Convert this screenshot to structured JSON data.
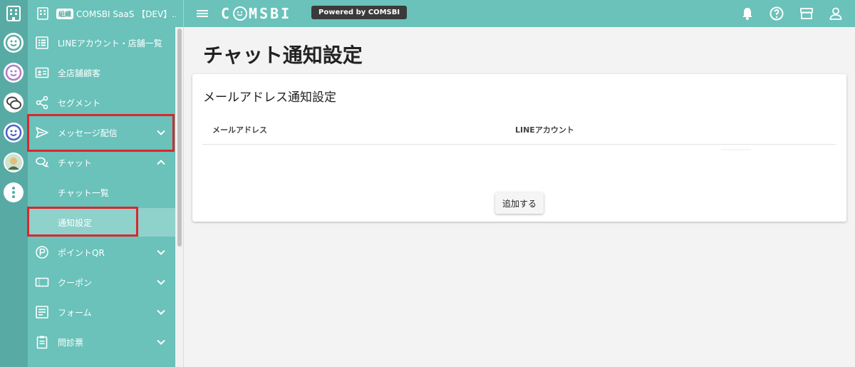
{
  "header": {
    "org_badge": "組織",
    "org_name": "COMSBI SaaS 【DEV】...",
    "logo_text": [
      "C",
      "MSBI"
    ],
    "powered_label": "Powered by COMSBI"
  },
  "sidebar": {
    "items": [
      {
        "label": "LINEアカウント・店舗一覧",
        "icon": "list-icon"
      },
      {
        "label": "全店舗顧客",
        "icon": "customer-card-icon"
      },
      {
        "label": "セグメント",
        "icon": "share-segment-icon"
      },
      {
        "label": "メッセージ配信",
        "icon": "send-icon"
      },
      {
        "label": "チャット",
        "icon": "chat-icon"
      },
      {
        "label": "チャット一覧",
        "icon": ""
      },
      {
        "label": "通知設定",
        "icon": ""
      },
      {
        "label": "ポイントQR",
        "icon": "point-icon"
      },
      {
        "label": "クーポン",
        "icon": "coupon-icon"
      },
      {
        "label": "フォーム",
        "icon": "form-icon"
      },
      {
        "label": "問診票",
        "icon": "clipboard-icon"
      }
    ]
  },
  "main": {
    "page_title": "チャット通知設定",
    "card_title": "メールアドレス通知設定",
    "columns": [
      "メールアドレス",
      "LINEアカウント"
    ],
    "add_button": "追加する"
  },
  "colors": {
    "accent": "#6ac2ba",
    "rail": "#58aba4",
    "highlight": "#d9272e"
  }
}
